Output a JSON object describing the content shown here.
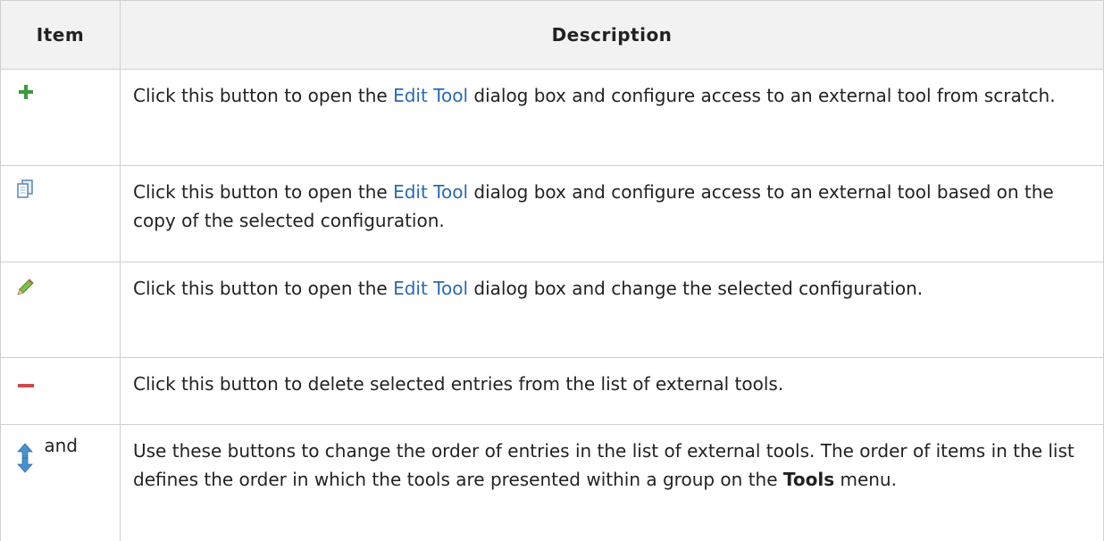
{
  "headers": {
    "item": "Item",
    "description": "Description"
  },
  "rows": [
    {
      "icon": "plus-icon",
      "pre": "Click this button to open the ",
      "link": "Edit Tool",
      "post": " dialog box and configure access to an external tool from scratch."
    },
    {
      "icon": "copy-icon",
      "pre": "Click this button to open the ",
      "link": "Edit Tool",
      "post": " dialog box and configure access to an external tool based on the copy of the selected configuration."
    },
    {
      "icon": "edit-pencil-icon",
      "pre": "Click this button to open the ",
      "link": "Edit Tool",
      "post": " dialog box and change the selected configuration."
    },
    {
      "icon": "minus-icon",
      "text": "Click this button to delete selected entries from the list of external tools."
    },
    {
      "icon": "up-down-arrows-icon",
      "and": "and",
      "pre": "Use these buttons to change the order of entries in the list of external tools. The order of items in the list defines the order in which the tools are presented within a group on the ",
      "bold": "Tools",
      "post": " menu."
    }
  ],
  "colors": {
    "plus": "#3c9a3c",
    "minus": "#c94a4a",
    "link": "#2a6ab3",
    "header_bg": "#f2f2f2",
    "border": "#cfcfcf"
  }
}
